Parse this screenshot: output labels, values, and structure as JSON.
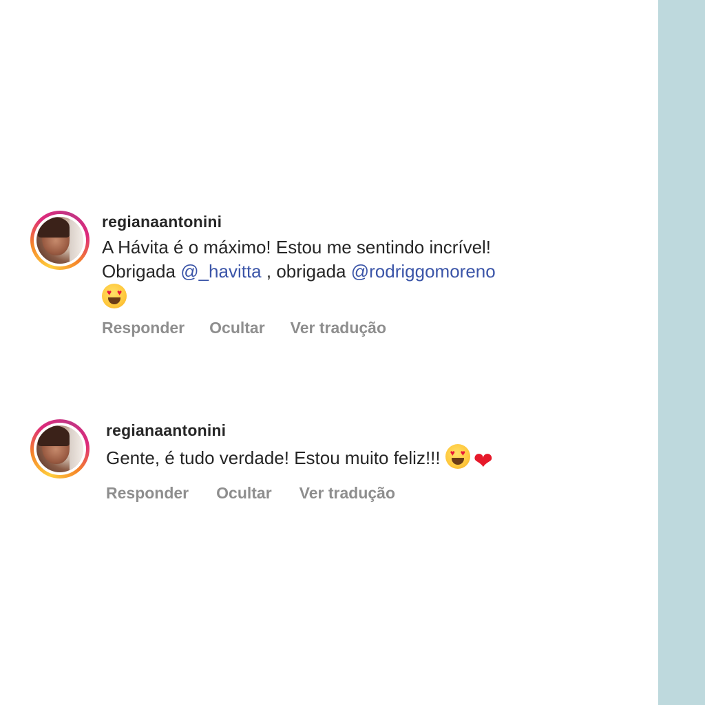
{
  "colors": {
    "side_strip": "#bed9dd",
    "mention": "#3b55a8",
    "action_text": "#8e8e8e"
  },
  "comments": [
    {
      "username": "regianaantonini",
      "text_line1": "A Hávita é o máximo! Estou me sentindo incrível!",
      "text_prefix": "Obrigada ",
      "mention1": "@_havitta",
      "text_middle": " , obrigada ",
      "mention2": "@rodriggomoreno",
      "emojis": [
        "smiling-face-with-heart-eyes"
      ],
      "actions": {
        "reply": "Responder",
        "hide": "Ocultar",
        "translate": "Ver tradução"
      }
    },
    {
      "username": "regianaantonini",
      "text": "Gente, é tudo verdade! Estou muito feliz!!!",
      "emojis": [
        "smiling-face-with-heart-eyes",
        "red-heart"
      ],
      "actions": {
        "reply": "Responder",
        "hide": "Ocultar",
        "translate": "Ver tradução"
      }
    }
  ]
}
